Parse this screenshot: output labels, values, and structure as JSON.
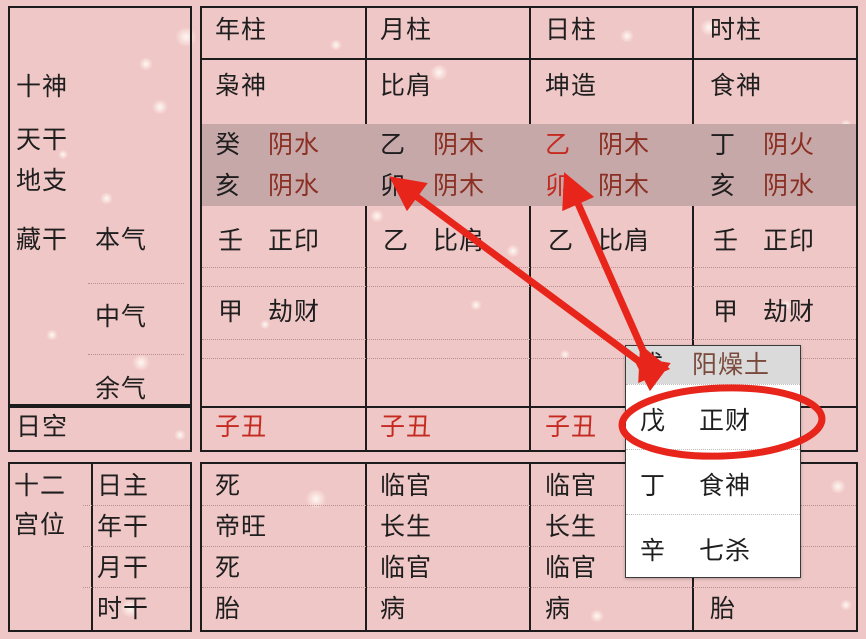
{
  "theme": {
    "bg": "#efc7c6",
    "grid": "#1c1c1c",
    "highlight_row_bg": "#c7a8a9",
    "red_text": "#c52a20",
    "brown_text": "#8a2f22",
    "annotation_red": "#e8251b",
    "popup_bg": "#ffffff",
    "popup_header_bg": "#dadada"
  },
  "left_labels": {
    "ten_gods": "十神",
    "heavenly_stem": "天干",
    "earthly_branch": "地支",
    "hidden_stems": "藏干",
    "hidden_main": "本气",
    "hidden_middle": "中气",
    "hidden_residual": "余气",
    "day_void": "日空",
    "twelve_palaces": "十二宫位",
    "twelve_palaces_line1": "十二",
    "twelve_palaces_line2": "宫位",
    "palace_rows": [
      "日主",
      "年干",
      "月干",
      "时干"
    ]
  },
  "columns": [
    {
      "id": "year",
      "header": "年柱",
      "ten_god": "枭神",
      "stem": {
        "char": "癸",
        "element": "阴水",
        "red": false
      },
      "branch": {
        "char": "亥",
        "element": "阴水",
        "red": false
      },
      "hidden": [
        {
          "stem": "壬",
          "god": "正印"
        },
        {
          "stem": "甲",
          "god": "劫财"
        },
        {
          "stem": "",
          "god": ""
        }
      ],
      "day_void": "子丑",
      "palaces": [
        "死",
        "帝旺",
        "死",
        "胎"
      ]
    },
    {
      "id": "month",
      "header": "月柱",
      "ten_god": "比肩",
      "stem": {
        "char": "乙",
        "element": "阴木",
        "red": false
      },
      "branch": {
        "char": "卯",
        "element": "阴木",
        "red": false
      },
      "hidden": [
        {
          "stem": "乙",
          "god": "比肩"
        },
        {
          "stem": "",
          "god": ""
        },
        {
          "stem": "",
          "god": ""
        }
      ],
      "day_void": "子丑",
      "palaces": [
        "临官",
        "长生",
        "临官",
        "病"
      ]
    },
    {
      "id": "day",
      "header": "日柱",
      "ten_god": "坤造",
      "stem": {
        "char": "乙",
        "element": "阴木",
        "red": true
      },
      "branch": {
        "char": "卯",
        "element": "阴木",
        "red": true
      },
      "hidden": [
        {
          "stem": "乙",
          "god": "比肩"
        },
        {
          "stem": "",
          "god": ""
        },
        {
          "stem": "",
          "god": ""
        }
      ],
      "day_void": "子丑",
      "palaces": [
        "临官",
        "长生",
        "临官",
        "病"
      ]
    },
    {
      "id": "hour",
      "header": "时柱",
      "ten_god": "食神",
      "stem": {
        "char": "丁",
        "element": "阴火",
        "red": false
      },
      "branch": {
        "char": "亥",
        "element": "阴水",
        "red": false
      },
      "hidden": [
        {
          "stem": "壬",
          "god": "正印"
        },
        {
          "stem": "甲",
          "god": "劫财"
        },
        {
          "stem": "",
          "god": ""
        }
      ],
      "day_void": "",
      "palaces": [
        "",
        "",
        "",
        "胎"
      ]
    }
  ],
  "popup": {
    "header_branch": "戌",
    "header_element": "阳燥土",
    "rows": [
      {
        "stem": "戊",
        "god": "正财",
        "circled": true
      },
      {
        "stem": "丁",
        "god": "食神",
        "circled": false
      },
      {
        "stem": "辛",
        "god": "七杀",
        "circled": false
      }
    ]
  },
  "annotations": {
    "arrow_count": 2,
    "circle_target": "戊 正财",
    "color": "#e8251b"
  }
}
